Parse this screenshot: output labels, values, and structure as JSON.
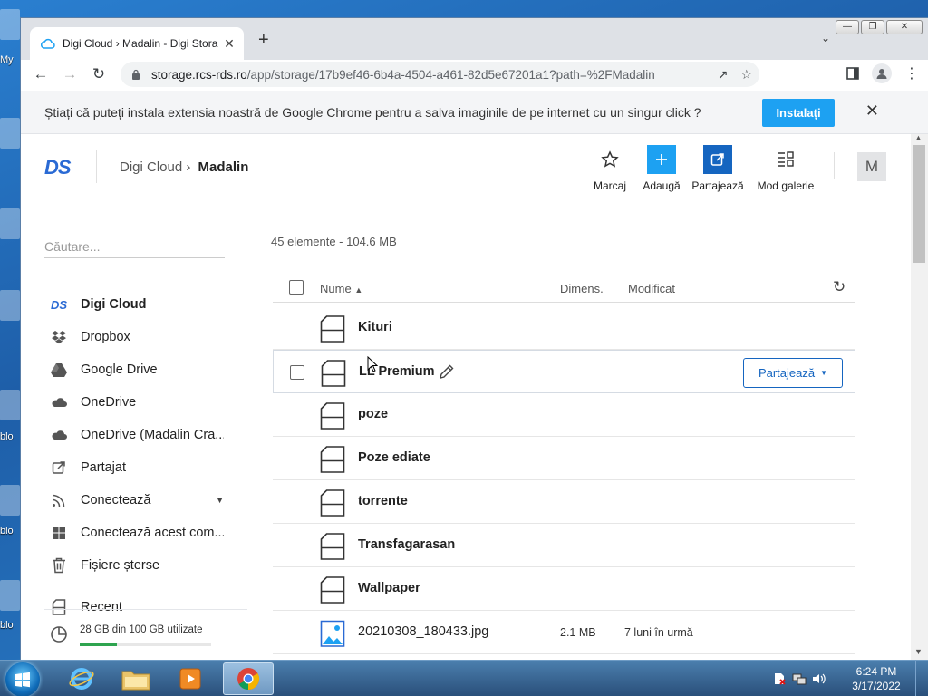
{
  "desktop": {
    "labels": [
      "My",
      "blo",
      "blo",
      "blo"
    ]
  },
  "browser": {
    "tab": {
      "title": "Digi Cloud › Madalin - Digi Stora",
      "close": "✕"
    },
    "new_tab": "+",
    "tab_menu": "⌄",
    "window_controls": {
      "minimize": "—",
      "maximize": "❐",
      "close": "✕"
    },
    "url_host": "storage.rcs-rds.ro",
    "url_path": "/app/storage/17b9ef46-6b4a-4504-a461-82d5e67201a1?path=%2FMadalin"
  },
  "infobar": {
    "text": "Știați că puteți instala extensia noastră de Google Chrome pentru a salva imaginile de pe internet cu un singur click ?",
    "install_label": "Instalați",
    "close": "✕"
  },
  "header": {
    "logo": "DS",
    "breadcrumb_root": "Digi Cloud",
    "breadcrumb_sep": "›",
    "breadcrumb_current": "Madalin",
    "actions": [
      {
        "label": "Marcaj"
      },
      {
        "label": "Adaugă"
      },
      {
        "label": "Partajează"
      },
      {
        "label": "Mod galerie"
      }
    ],
    "avatar": "M"
  },
  "sidebar": {
    "search_placeholder": "Căutare...",
    "items": [
      {
        "label": "Digi Cloud"
      },
      {
        "label": "Dropbox"
      },
      {
        "label": "Google Drive"
      },
      {
        "label": "OneDrive"
      },
      {
        "label": "OneDrive (Madalin Cra..."
      },
      {
        "label": "Partajat"
      },
      {
        "label": "Conectează"
      },
      {
        "label": "Conectează acest com..."
      },
      {
        "label": "Fișiere șterse"
      },
      {
        "label": "Recent"
      }
    ],
    "storage": {
      "text": "28 GB din 100 GB utilizate",
      "used_fraction": 0.28
    }
  },
  "content": {
    "summary": "45 elemente - 104.6 MB",
    "columns": {
      "name": "Nume",
      "size": "Dimens.",
      "modified": "Modificat"
    },
    "rows": [
      {
        "name": "Kituri",
        "size": "",
        "modified": ""
      },
      {
        "name": "LL Premium",
        "size": "",
        "modified": ""
      },
      {
        "name": "poze",
        "size": "",
        "modified": ""
      },
      {
        "name": "Poze ediate",
        "size": "",
        "modified": ""
      },
      {
        "name": "torrente",
        "size": "",
        "modified": ""
      },
      {
        "name": "Transfagarasan",
        "size": "",
        "modified": ""
      },
      {
        "name": "Wallpaper",
        "size": "",
        "modified": ""
      },
      {
        "name": "20210308_180433.jpg",
        "size": "2.1 MB",
        "modified": "7 luni în urmă"
      }
    ],
    "share_label": "Partajează"
  },
  "taskbar": {
    "time": "6:24 PM",
    "date": "3/17/2022"
  }
}
